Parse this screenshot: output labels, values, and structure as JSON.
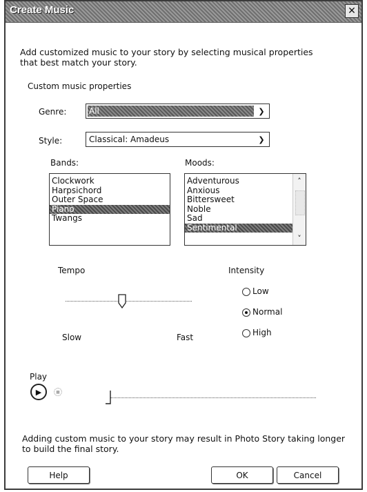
{
  "window": {
    "title": "Create Music",
    "close_glyph": "✕"
  },
  "intro_text": "Add customized music to your story by selecting musical properties that best match your story.",
  "section_label": "Custom music properties",
  "genre": {
    "label": "Genre:",
    "value": "All"
  },
  "style": {
    "label": "Style:",
    "value": "Classical: Amadeus"
  },
  "bands": {
    "label": "Bands:",
    "items": [
      "Clockwork",
      "Harpsichord",
      "Outer Space",
      "Piano",
      "Twangs"
    ],
    "selected": "Piano"
  },
  "moods": {
    "label": "Moods:",
    "items": [
      "Adventurous",
      "Anxious",
      "Bittersweet",
      "Noble",
      "Sad",
      "Sentimental"
    ],
    "selected": "Sentimental"
  },
  "tempo": {
    "label": "Tempo",
    "min_label": "Slow",
    "max_label": "Fast",
    "level": 0.45
  },
  "intensity": {
    "label": "Intensity",
    "options": [
      "Low",
      "Normal",
      "High"
    ],
    "selected": "Normal"
  },
  "play": {
    "label": "Play",
    "progress": 0.0
  },
  "footer_note": "Adding custom music to your story may result in Photo Story taking longer to build the final story.",
  "buttons": {
    "help": "Help",
    "ok": "OK",
    "cancel": "Cancel"
  },
  "icons": {
    "close": "close-icon",
    "dropdown": "chevron-down-icon",
    "play": "play-icon",
    "stop": "stop-icon"
  }
}
